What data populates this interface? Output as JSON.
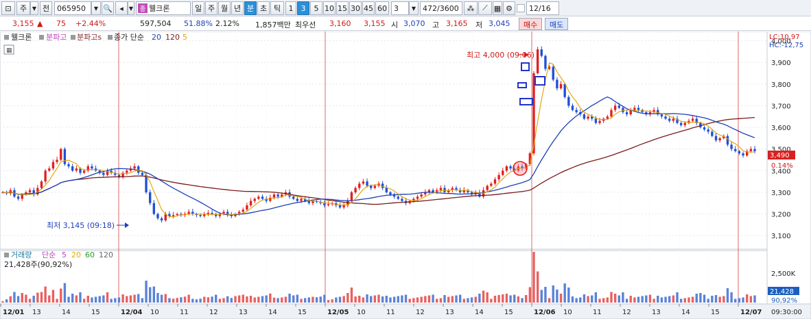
{
  "toolbar": {
    "period_label": "주",
    "prev_label": "전",
    "stock_code": "065950",
    "stock_tag": "종",
    "stock_name": "웰크론",
    "period_buttons": [
      "일",
      "주",
      "월",
      "년",
      "분",
      "초",
      "틱"
    ],
    "active_period": "분",
    "minute_buttons": [
      "1",
      "3",
      "5",
      "10",
      "15",
      "30",
      "45",
      "60"
    ],
    "active_minute": "3",
    "minute_select": "3",
    "count_value": "472",
    "count_total": "/3600",
    "date_value": "12/16"
  },
  "quote": {
    "price": "3,155",
    "direction": "▲",
    "change": "75",
    "change_pct": "+2.44%",
    "volume": "597,504",
    "volume_ratio": "51.88%",
    "turnover_pct": "2.12%",
    "trade_value": "1,857백만",
    "best_bid_label": "최우선",
    "best_ask": "3,160",
    "best_bid": "3,155",
    "open_label": "시",
    "open": "3,070",
    "high_label": "고",
    "high": "3,165",
    "low_label": "저",
    "low": "3,045",
    "buy_label": "매수",
    "sell_label": "매도"
  },
  "legend": {
    "stock": "웰크론",
    "items": [
      "분파고",
      "분파고s"
    ],
    "ma_title": "종가 단순",
    "ma_periods": [
      "20",
      "120",
      "5"
    ],
    "ma_colors": [
      "#1c3fb8",
      "#7a1a1a",
      "#e0a000"
    ]
  },
  "volume_legend": {
    "title": "거래량",
    "ma_title": "단순",
    "periods": [
      "5",
      "20",
      "60",
      "120"
    ],
    "period_colors": [
      "#c040c0",
      "#d8b000",
      "#2a9a2a",
      "#666666"
    ],
    "current": "21,428주(90,92%)"
  },
  "price_axis": {
    "lc": "LC:10,97",
    "hc": "HC:-12,75",
    "ticks": [
      "4,000",
      "3,900",
      "3,800",
      "3,700",
      "3,600",
      "3,500",
      "3,400",
      "3,300",
      "3,200",
      "3,100"
    ],
    "current_label": "3,490",
    "current_pct": "0.14%"
  },
  "volume_axis": {
    "tick": "2,500K",
    "current_label": "21,428",
    "current_pct": "90,92%"
  },
  "annotations": {
    "high": "최고 4,000 (09:06)",
    "low": "최저 3,145 (09:18)"
  },
  "time_axis": {
    "labels": [
      "12/01",
      "13",
      "14",
      "15",
      "12/04",
      "10",
      "11",
      "12",
      "13",
      "14",
      "15",
      "12/05",
      "10",
      "11",
      "12",
      "13",
      "14",
      "15",
      "12/06",
      "10",
      "11",
      "12",
      "13",
      "14",
      "15",
      "12/07"
    ],
    "end_time": "09:30:00"
  },
  "chart_data": {
    "type": "candlestick",
    "ylim": [
      3050,
      4030
    ],
    "close": [
      3300,
      3295,
      3310,
      3280,
      3270,
      3290,
      3300,
      3310,
      3290,
      3320,
      3350,
      3400,
      3410,
      3440,
      3450,
      3500,
      3430,
      3420,
      3400,
      3410,
      3390,
      3400,
      3420,
      3410,
      3400,
      3390,
      3380,
      3400,
      3390,
      3380,
      3370,
      3390,
      3400,
      3410,
      3420,
      3390,
      3380,
      3300,
      3250,
      3200,
      3180,
      3170,
      3200,
      3190,
      3195,
      3200,
      3195,
      3200,
      3210,
      3200,
      3195,
      3190,
      3200,
      3205,
      3200,
      3190,
      3200,
      3210,
      3195,
      3190,
      3200,
      3210,
      3220,
      3240,
      3260,
      3270,
      3280,
      3270,
      3260,
      3275,
      3290,
      3280,
      3290,
      3300,
      3280,
      3270,
      3260,
      3270,
      3260,
      3250,
      3260,
      3255,
      3250,
      3240,
      3245,
      3250,
      3240,
      3230,
      3240,
      3260,
      3300,
      3320,
      3340,
      3350,
      3330,
      3320,
      3330,
      3340,
      3320,
      3300,
      3290,
      3280,
      3270,
      3260,
      3250,
      3260,
      3270,
      3280,
      3290,
      3300,
      3310,
      3300,
      3310,
      3320,
      3300,
      3310,
      3320,
      3310,
      3300,
      3310,
      3300,
      3290,
      3300,
      3280,
      3310,
      3330,
      3340,
      3360,
      3380,
      3400,
      3420,
      3410,
      3400,
      3420,
      3410,
      3430,
      3480,
      3850,
      3960,
      3930,
      3870,
      3880,
      3820,
      3780,
      3800,
      3740,
      3700,
      3680,
      3670,
      3660,
      3640,
      3650,
      3640,
      3620,
      3630,
      3640,
      3650,
      3680,
      3700,
      3690,
      3670,
      3660,
      3680,
      3690,
      3680,
      3670,
      3660,
      3670,
      3680,
      3660,
      3650,
      3640,
      3630,
      3640,
      3620,
      3610,
      3620,
      3630,
      3640,
      3620,
      3600,
      3590,
      3580,
      3560,
      3540,
      3550,
      3560,
      3520,
      3500,
      3490,
      3480,
      3470,
      3490,
      3500,
      3490
    ]
  }
}
